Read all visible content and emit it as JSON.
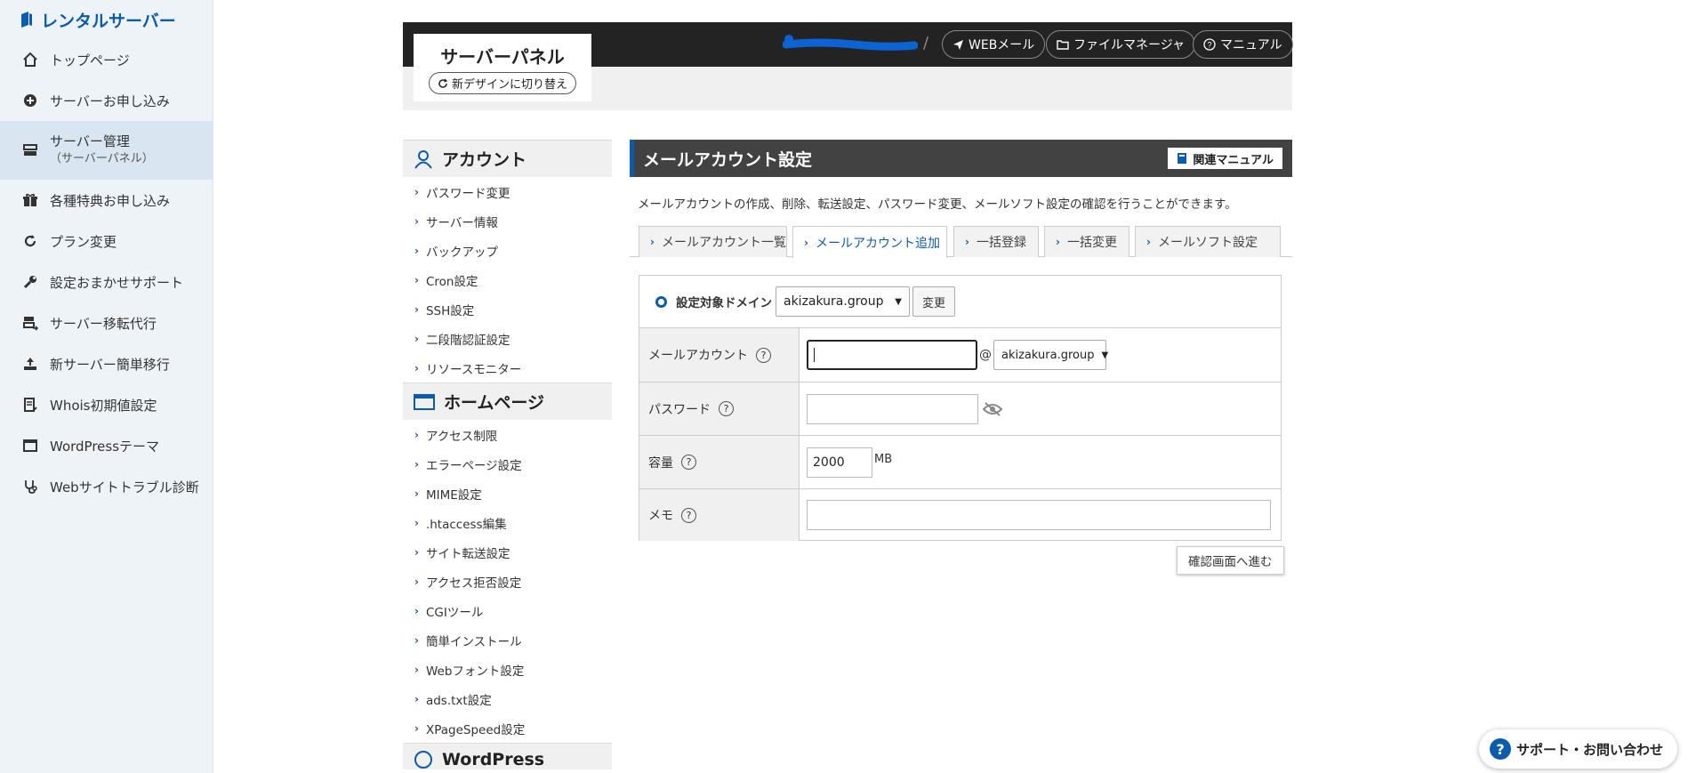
{
  "app": {
    "brand": "レンタルサーバー"
  },
  "nav": {
    "items": [
      {
        "label": "トップページ",
        "icon": "home-icon"
      },
      {
        "label": "サーバーお申し込み",
        "icon": "plus-circle-icon"
      },
      {
        "label": "サーバー管理",
        "sub": "（サーバーパネル）",
        "icon": "server-icon",
        "active": true
      },
      {
        "label": "各種特典お申し込み",
        "icon": "gift-icon"
      },
      {
        "label": "プラン変更",
        "icon": "refresh-icon"
      },
      {
        "label": "設定おまかせサポート",
        "icon": "wrench-icon"
      },
      {
        "label": "サーバー移転代行",
        "icon": "server-move-icon"
      },
      {
        "label": "新サーバー簡単移行",
        "icon": "upload-icon"
      },
      {
        "label": "Whois初期値設定",
        "icon": "document-edit-icon"
      },
      {
        "label": "WordPressテーマ",
        "icon": "window-icon"
      },
      {
        "label": "Webサイトトラブル診断",
        "icon": "stethoscope-icon"
      }
    ]
  },
  "header": {
    "panel_title": "サーバーパネル",
    "switch_label": "新デザインに切り替え",
    "separator": "/",
    "buttons": [
      {
        "label": "WEBメール",
        "icon": "send-icon"
      },
      {
        "label": "ファイルマネージャ",
        "icon": "folder-icon"
      },
      {
        "label": "マニュアル",
        "icon": "help-icon"
      }
    ]
  },
  "side": {
    "sections": [
      {
        "title": "アカウント",
        "icon": "user-icon",
        "items": [
          "パスワード変更",
          "サーバー情報",
          "バックアップ",
          "Cron設定",
          "SSH設定",
          "二段階認証設定",
          "リソースモニター"
        ]
      },
      {
        "title": "ホームページ",
        "icon": "browser-icon",
        "items": [
          "アクセス制限",
          "エラーページ設定",
          "MIME設定",
          ".htaccess編集",
          "サイト転送設定",
          "アクセス拒否設定",
          "CGIツール",
          "簡単インストール",
          "Webフォント設定",
          "ads.txt設定",
          "XPageSpeed設定"
        ]
      }
    ],
    "next_section": "WordPress"
  },
  "main": {
    "title": "メールアカウント設定",
    "manual_label": "関連マニュアル",
    "description": "メールアカウントの作成、削除、転送設定、パスワード変更、メールソフト設定の確認を行うことができます。",
    "tabs": [
      "メールアカウント一覧",
      "メールアカウント追加",
      "一括登録",
      "一括変更",
      "メールソフト設定"
    ],
    "active_tab": 1,
    "domain_label": "設定対象ドメイン",
    "domain_value": "akizakura.group",
    "change_label": "変更",
    "fields": {
      "account_label": "メールアカウント",
      "at": "@",
      "account_domain": "akizakura.group",
      "password_label": "パスワード",
      "quota_label": "容量",
      "quota_value": "2000",
      "quota_unit": "MB",
      "memo_label": "メモ",
      "help": "?"
    },
    "confirm_label": "確認画面へ進む"
  },
  "support": {
    "label": "サポート・お問い合わせ",
    "q": "?"
  }
}
